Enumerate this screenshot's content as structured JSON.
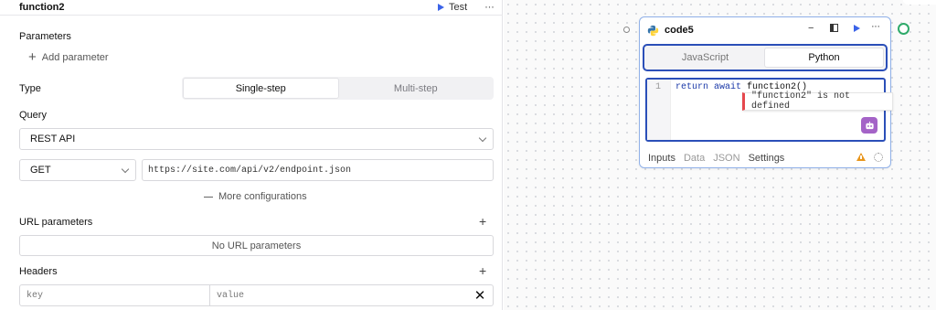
{
  "panel": {
    "title": "function2",
    "test_label": "Test",
    "more": "···"
  },
  "parameters": {
    "label": "Parameters",
    "add": "Add parameter"
  },
  "type": {
    "label": "Type",
    "options": [
      "Single-step",
      "Multi-step"
    ],
    "selected": "Single-step"
  },
  "query": {
    "label": "Query",
    "resource": "REST API",
    "method": "GET",
    "url_placeholder": "https://site.com/api/v2/endpoint.json",
    "more_config": "More configurations"
  },
  "url_params": {
    "label": "URL parameters",
    "empty": "No URL parameters"
  },
  "headers": {
    "label": "Headers",
    "key_placeholder": "key",
    "value_placeholder": "value"
  },
  "node": {
    "title": "code5",
    "lang_tabs": [
      "JavaScript",
      "Python"
    ],
    "lang_selected": "Python",
    "line_number": "1",
    "code_kw": "return await",
    "code_fn": " function2()",
    "error": "\"function2\" is not defined",
    "tabs": [
      "Inputs",
      "Data",
      "JSON",
      "Settings"
    ]
  }
}
